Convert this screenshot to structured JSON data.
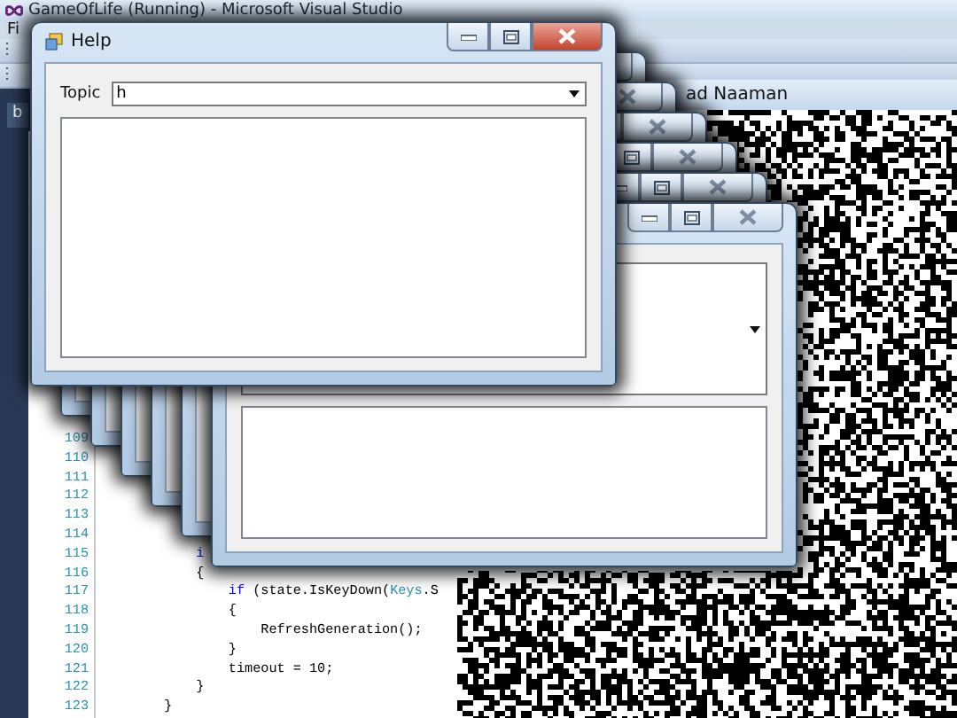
{
  "visual_studio": {
    "title": "GameOfLife (Running) - Microsoft Visual Studio",
    "menu": [
      "Fi"
    ],
    "document_tab": "b",
    "code_lines": [
      {
        "number": "109"
      },
      {
        "number": "110"
      },
      {
        "number": "111"
      },
      {
        "number": "112"
      },
      {
        "number": "113"
      },
      {
        "number": "114"
      },
      {
        "number": "115",
        "segments": [
          {
            "kind": "keyword",
            "text": "            i"
          }
        ]
      },
      {
        "number": "116",
        "segments": [
          {
            "kind": "plain",
            "text": "            {"
          }
        ]
      },
      {
        "number": "117",
        "segments": [
          {
            "kind": "keyword",
            "text": "                if"
          },
          {
            "kind": "plain",
            "text": " (state.IsKeyDown("
          },
          {
            "kind": "type",
            "text": "Keys"
          },
          {
            "kind": "plain",
            "text": ".S"
          }
        ]
      },
      {
        "number": "118",
        "segments": [
          {
            "kind": "plain",
            "text": "                {"
          }
        ]
      },
      {
        "number": "119",
        "segments": [
          {
            "kind": "plain",
            "text": "                    RefreshGeneration();"
          }
        ]
      },
      {
        "number": "120",
        "segments": [
          {
            "kind": "plain",
            "text": "                }"
          }
        ]
      },
      {
        "number": "121",
        "segments": [
          {
            "kind": "plain",
            "text": "                timeout = 10;"
          }
        ]
      },
      {
        "number": "122",
        "segments": [
          {
            "kind": "plain",
            "text": "            }"
          }
        ]
      },
      {
        "number": "123",
        "segments": [
          {
            "kind": "plain",
            "text": "        }"
          }
        ]
      }
    ]
  },
  "game_window": {
    "title": "ad Naaman"
  },
  "stacked_windows": [
    {
      "kind": "dialog"
    },
    {
      "kind": "dialog"
    },
    {
      "kind": "dialog"
    },
    {
      "kind": "dialog"
    },
    {
      "kind": "dialog"
    },
    {
      "kind": "dialog"
    }
  ],
  "help_window": {
    "title": "Help",
    "active": true,
    "topic_label": "Topic",
    "topic_value": "h"
  }
}
